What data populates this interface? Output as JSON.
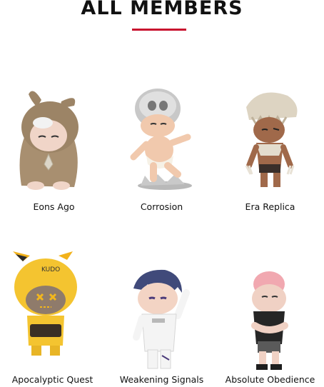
{
  "heading": {
    "title": "ALL MEMBERS",
    "accent_color": "#c8102e"
  },
  "members": [
    {
      "name": "Eons Ago",
      "icon": "hooded-rabbit-figure"
    },
    {
      "name": "Corrosion",
      "icon": "silver-skull-baby-figure"
    },
    {
      "name": "Era Replica",
      "icon": "dino-skull-warrior-figure"
    },
    {
      "name": "Apocalyptic Quest",
      "icon": "yellow-helmet-figure",
      "helmet_text": "KUDO"
    },
    {
      "name": "Weakening Signals",
      "icon": "astronaut-figure"
    },
    {
      "name": "Absolute Obedience",
      "icon": "pink-hair-figure"
    }
  ]
}
